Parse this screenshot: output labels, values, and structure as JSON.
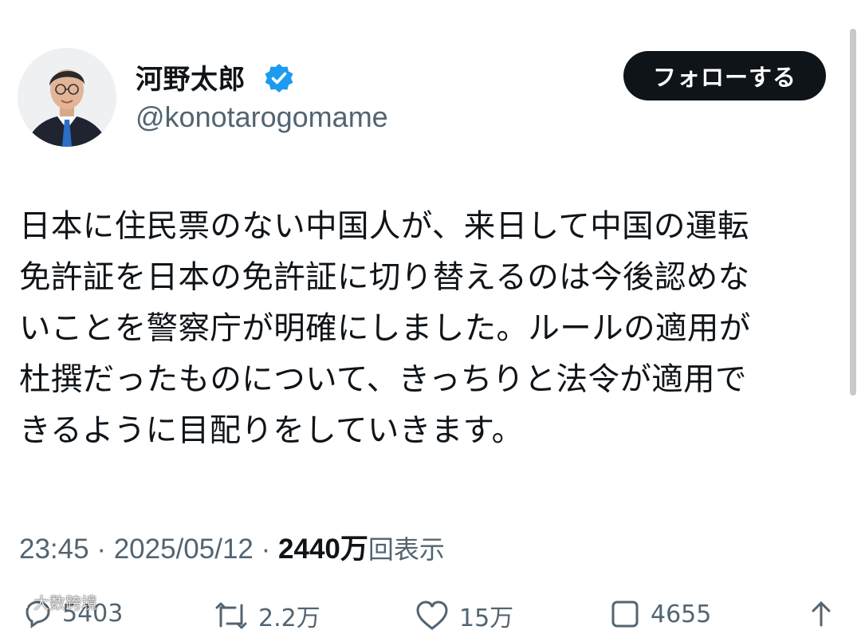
{
  "author": {
    "display_name": "河野太郎",
    "handle": "@konotarogomame",
    "verified": true
  },
  "follow_button": {
    "label": "フォローする"
  },
  "tweet": {
    "text": "日本に住民票のない中国人が、来日して中国の運転\n免許証を日本の免許証に切り替えるのは今後認めな\nいことを警察庁が明確にしました。ルールの適用が\n杜撰だったものについて、きっちりと法令が適用で\nきるように目配りをしていきます。",
    "time": "23:45",
    "separator": "·",
    "date": "2025/05/12",
    "views_count": "2440万",
    "views_label": "回表示"
  },
  "actions": {
    "replies": "5403",
    "retweets": "2.2万",
    "likes": "15万",
    "bookmarks": "4655"
  },
  "watermark": {
    "text": "大数跨境"
  },
  "icons": {
    "verified": "verified-badge-icon",
    "reply": "reply-icon",
    "retweet": "retweet-icon",
    "like": "heart-icon",
    "bookmark": "bookmark-icon",
    "share": "share-icon"
  },
  "colors": {
    "verified_blue": "#1d9bf0",
    "button_bg": "#0f1419",
    "secondary_text": "#536471"
  }
}
